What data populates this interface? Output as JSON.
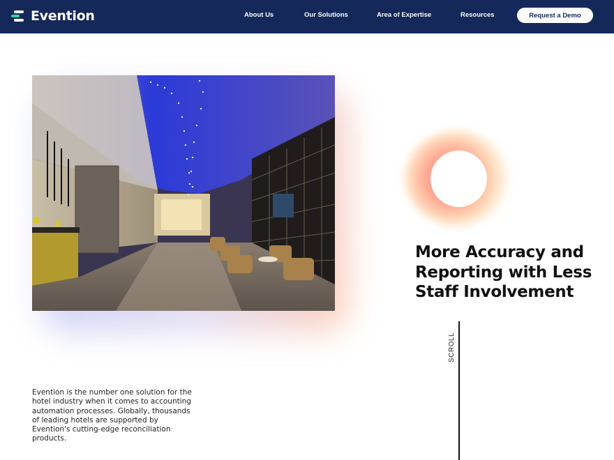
{
  "header": {
    "brand": "Evention",
    "nav": [
      {
        "label": "About Us"
      },
      {
        "label": "Our Solutions"
      },
      {
        "label": "Area of Expertise"
      },
      {
        "label": "Resources"
      }
    ],
    "cta_label": "Request a Demo"
  },
  "hero": {
    "image_subject": "hotel lobby with blue-lit ceiling and lounge seating",
    "headline": "More Accuracy and Reporting with Less Staff Involvement",
    "scroll_label": "SCROLL"
  },
  "intro": {
    "text": "Evention is the number one solution for the hotel industry when it comes to accounting automation processes. Globally, thousands of leading hotels are supported by Evention's cutting-edge reconciliation products."
  },
  "colors": {
    "header_bg": "#14285a",
    "brand_accent": "#39d3a5",
    "glow_accent": "#ff7070"
  }
}
